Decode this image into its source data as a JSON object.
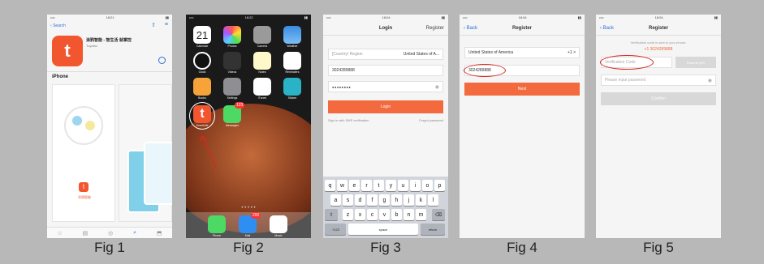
{
  "fig1": {
    "caption": "Fig 1",
    "back": "Search",
    "app_title": "涂鸦智能 - 智生活 就掌控",
    "app_sub": "TuyaInc",
    "section": "iPhone",
    "promo_label": "涂鸦智能"
  },
  "fig2": {
    "caption": "Fig  2",
    "date": "21",
    "time": "18:22",
    "apps": [
      "Calendar",
      "Photos",
      "Camera",
      "Weather",
      "Clock",
      "Videos",
      "Notes",
      "Reminders",
      "Books",
      "Settings",
      "iTunes",
      "Sticker"
    ],
    "tuya_label": "SmartLife",
    "messages_label": "Messages",
    "messages_badge": "123",
    "dock": [
      "Phone",
      "Mail",
      "Music"
    ],
    "mail_badge": "290"
  },
  "fig3": {
    "caption": "Fig 3",
    "title": "Login",
    "register": "Register",
    "region_label": "[Country/ Region",
    "region_value": "United States of A...",
    "phone": "3024289888",
    "password": "●●●●●●●●",
    "login_btn": "Login",
    "sms_link": "Sign in with SMS verification",
    "forgot_link": "Forgot password",
    "keys_row1": [
      "q",
      "w",
      "e",
      "r",
      "t",
      "y",
      "u",
      "i",
      "o",
      "p"
    ],
    "keys_row2": [
      "a",
      "s",
      "d",
      "f",
      "g",
      "h",
      "j",
      "k",
      "l"
    ],
    "keys_row3": [
      "z",
      "x",
      "c",
      "v",
      "b",
      "n",
      "m"
    ],
    "key_123": ".?123",
    "key_space": "space",
    "key_return": "return"
  },
  "fig4": {
    "caption": "Fig 4",
    "back": "Back",
    "title": "Register",
    "country": "United States of America",
    "code": "+1 >",
    "phone": "3024289888",
    "next_btn": "Next"
  },
  "fig5": {
    "caption": "Fig 5",
    "back": "Back",
    "title": "Register",
    "sent_text": "Verification code is sent to your phone:",
    "sent_number": "+1 3024289888",
    "code_placeholder": "Verification Code",
    "resend": "Resend (59)",
    "password_placeholder": "Please input password",
    "confirm_btn": "Confirm"
  },
  "colors": {
    "accent": "#f26a3d",
    "ios_blue": "#2a6fd6",
    "circle": "#d9281f"
  }
}
